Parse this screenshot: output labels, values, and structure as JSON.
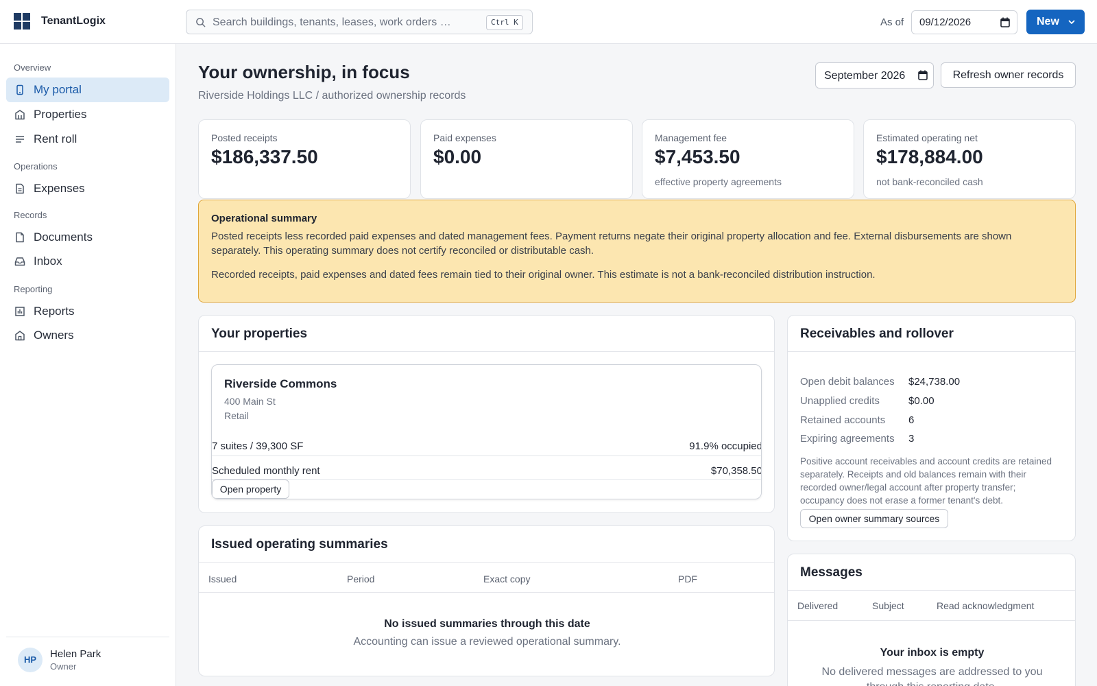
{
  "app": {
    "name": "TenantLogix"
  },
  "search": {
    "placeholder": "Search buildings, tenants, leases, work orders — o...",
    "shortcut": "Ctrl K"
  },
  "header": {
    "as_of_label": "As of",
    "as_of_date": "09/12/2026",
    "new_label": "New"
  },
  "sidebar": {
    "sections": [
      "Overview",
      "Operations",
      "Records",
      "Reporting"
    ],
    "items": [
      {
        "label": "My portal",
        "icon": "phone-icon",
        "active": true
      },
      {
        "label": "Properties",
        "icon": "building-icon",
        "active": false
      },
      {
        "label": "Rent roll",
        "icon": "list-icon",
        "active": false
      },
      {
        "label": "Expenses",
        "icon": "receipt-icon",
        "active": false
      },
      {
        "label": "Documents",
        "icon": "document-icon",
        "active": false
      },
      {
        "label": "Inbox",
        "icon": "inbox-icon",
        "active": false
      },
      {
        "label": "Reports",
        "icon": "report-icon",
        "active": false
      },
      {
        "label": "Owners",
        "icon": "home-icon",
        "active": false
      }
    ]
  },
  "user": {
    "initials": "HP",
    "name": "Helen Park",
    "role": "Owner"
  },
  "page": {
    "title": "Your ownership, in focus",
    "subtitle": "Riverside Holdings LLC / authorized ownership records",
    "period": "September  2026",
    "refresh_label": "Refresh owner records"
  },
  "kpis": [
    {
      "label": "Posted receipts",
      "value": "$186,337.50",
      "note": ""
    },
    {
      "label": "Paid expenses",
      "value": "$0.00",
      "note": ""
    },
    {
      "label": "Management fee",
      "value": "$7,453.50",
      "note": "effective property agreements"
    },
    {
      "label": "Estimated operating net",
      "value": "$178,884.00",
      "note": "not bank-reconciled cash"
    }
  ],
  "summary": {
    "title": "Operational summary",
    "p1": "Posted receipts less recorded paid expenses and dated management fees. Payment returns negate their original property allocation and fee. External disbursements are shown separately. This operating summary does not certify reconciled or distributable cash.",
    "p2": "Recorded receipts, paid expenses and dated fees remain tied to their original owner. This estimate is not a bank-reconciled distribution instruction."
  },
  "properties": {
    "title": "Your properties",
    "items": [
      {
        "name": "Riverside Commons",
        "address": "400 Main St",
        "type": "Retail",
        "suites": "7 suites / 39,300 SF",
        "occupancy": "91.9% occupied",
        "rent_label": "Scheduled monthly rent",
        "rent_value": "$70,358.50",
        "open_label": "Open property"
      }
    ]
  },
  "summaries": {
    "title": "Issued operating summaries",
    "columns": [
      "Issued",
      "Period",
      "Exact copy",
      "PDF"
    ],
    "empty_title": "No issued summaries through this date",
    "empty_sub": "Accounting can issue a reviewed operational summary."
  },
  "receivables": {
    "title": "Receivables and rollover",
    "rows": [
      {
        "label": "Open debit balances",
        "value": "$24,738.00"
      },
      {
        "label": "Unapplied credits",
        "value": "$0.00"
      },
      {
        "label": "Retained accounts",
        "value": "6"
      },
      {
        "label": "Expiring agreements",
        "value": "3"
      }
    ],
    "note": "Positive account receivables and account credits are retained separately. Receipts and old balances remain with their recorded owner/legal account after property transfer; occupancy does not erase a former tenant's debt.",
    "sources_label": "Open owner summary sources"
  },
  "messages": {
    "title": "Messages",
    "columns": [
      "Delivered",
      "Subject",
      "Read acknowledgment"
    ],
    "empty_title": "Your inbox is empty",
    "empty_sub": "No delivered messages are addressed to you through this reporting date."
  },
  "colors": {
    "accent": "#1565c0",
    "active_bg": "#dceaf7",
    "warning_bg": "#fce6b0",
    "warning_border": "#e0a63a"
  }
}
